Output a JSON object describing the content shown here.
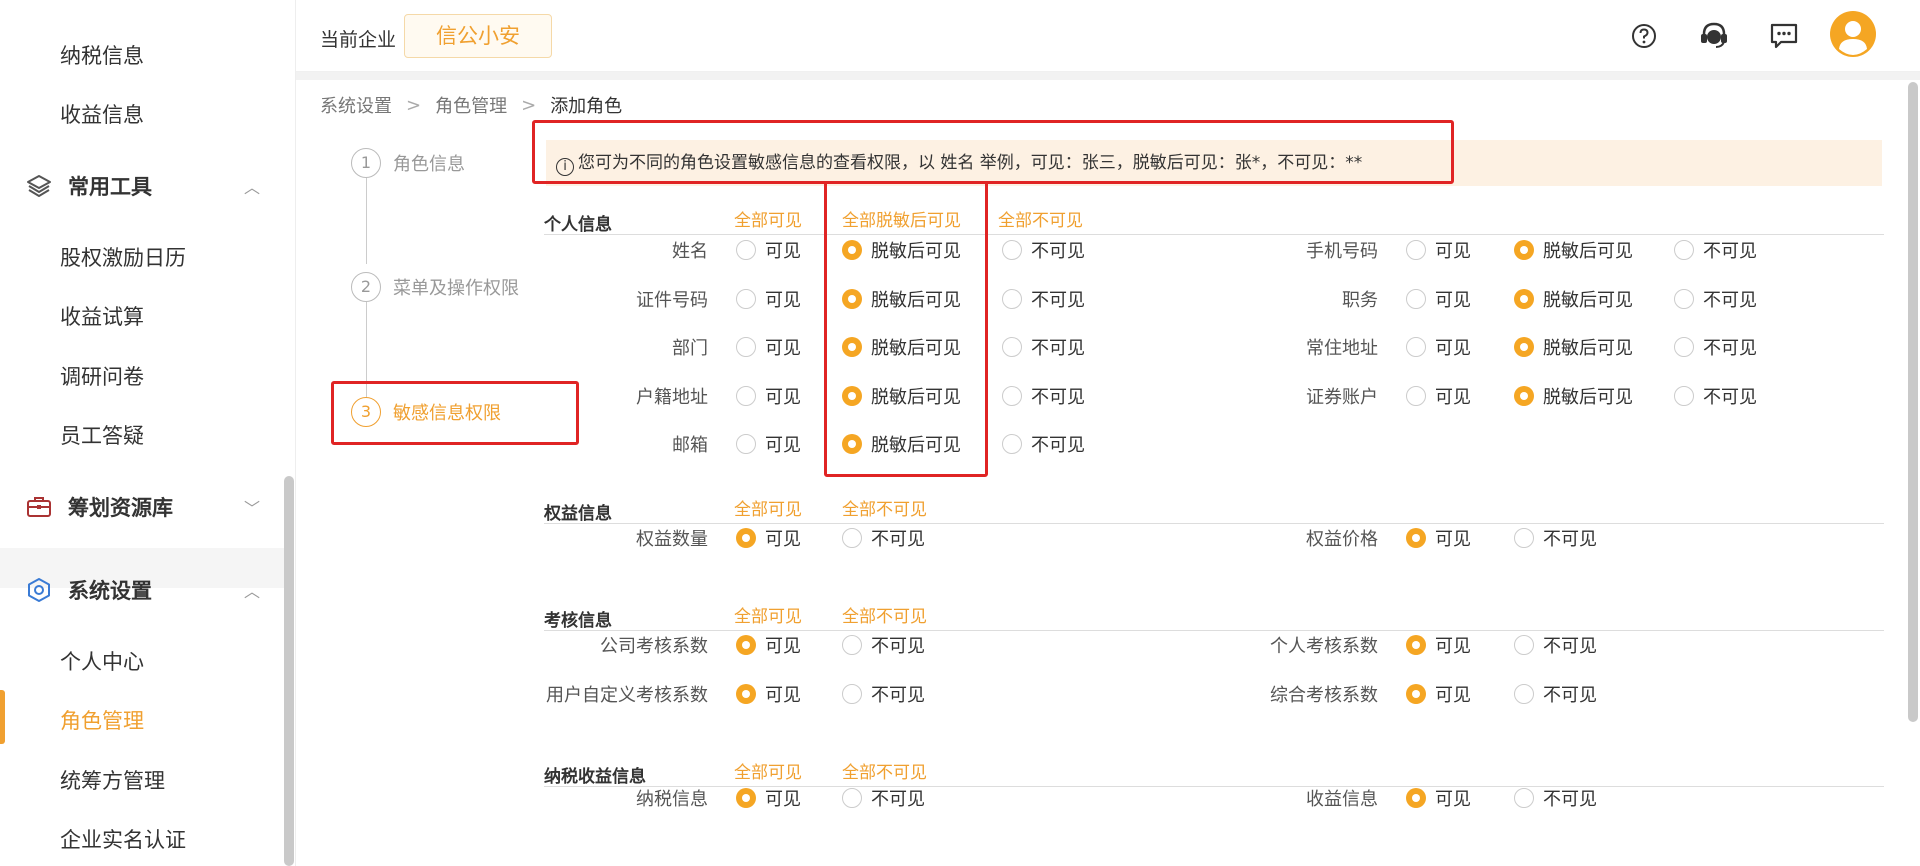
{
  "sidebar": {
    "top_items": [
      "纳税信息",
      "收益信息"
    ],
    "groups": [
      {
        "label": "常用工具",
        "items": [
          "股权激励日历",
          "收益试算",
          "调研问卷",
          "员工答疑"
        ],
        "expanded": true
      },
      {
        "label": "筹划资源库",
        "items": [],
        "expanded": false
      },
      {
        "label": "系统设置",
        "items": [
          "个人中心",
          "角色管理",
          "统筹方管理",
          "企业实名认证"
        ],
        "expanded": true
      }
    ],
    "active_item": "角色管理"
  },
  "header": {
    "current_company_label": "当前企业",
    "current_company": "信公小安",
    "icons": [
      "help-icon",
      "customer-service-icon",
      "message-icon",
      "avatar-icon"
    ]
  },
  "breadcrumb": [
    "系统设置",
    "角色管理",
    "添加角色"
  ],
  "steps": [
    {
      "num": "1",
      "label": "角色信息"
    },
    {
      "num": "2",
      "label": "菜单及操作权限"
    },
    {
      "num": "3",
      "label": "敏感信息权限",
      "active": true
    }
  ],
  "notice": "您可为不同的角色设置敏感信息的查看权限，以 姓名 举例，可见：张三，脱敏后可见：张*，不可见：**",
  "sections": {
    "personal": {
      "title": "个人信息",
      "links": [
        "全部可见",
        "全部脱敏后可见",
        "全部不可见"
      ],
      "options": [
        "可见",
        "脱敏后可见",
        "不可见"
      ],
      "left_fields": [
        {
          "label": "姓名",
          "selected": 1
        },
        {
          "label": "证件号码",
          "selected": 1
        },
        {
          "label": "部门",
          "selected": 1
        },
        {
          "label": "户籍地址",
          "selected": 1
        },
        {
          "label": "邮箱",
          "selected": 1
        }
      ],
      "right_fields": [
        {
          "label": "手机号码",
          "selected": 1
        },
        {
          "label": "职务",
          "selected": 1
        },
        {
          "label": "常住地址",
          "selected": 1
        },
        {
          "label": "证券账户",
          "selected": 1
        }
      ]
    },
    "equity": {
      "title": "权益信息",
      "links": [
        "全部可见",
        "全部不可见"
      ],
      "options": [
        "可见",
        "不可见"
      ],
      "left_fields": [
        {
          "label": "权益数量",
          "selected": 0
        }
      ],
      "right_fields": [
        {
          "label": "权益价格",
          "selected": 0
        }
      ]
    },
    "assessment": {
      "title": "考核信息",
      "links": [
        "全部可见",
        "全部不可见"
      ],
      "options": [
        "可见",
        "不可见"
      ],
      "left_fields": [
        {
          "label": "公司考核系数",
          "selected": 0
        },
        {
          "label": "用户自定义考核系数",
          "selected": 0
        }
      ],
      "right_fields": [
        {
          "label": "个人考核系数",
          "selected": 0
        },
        {
          "label": "综合考核系数",
          "selected": 0
        }
      ]
    },
    "tax": {
      "title": "纳税收益信息",
      "links": [
        "全部可见",
        "全部不可见"
      ],
      "options": [
        "可见",
        "不可见"
      ],
      "left_fields": [
        {
          "label": "纳税信息",
          "selected": 0
        }
      ],
      "right_fields": [
        {
          "label": "收益信息",
          "selected": 0
        }
      ]
    }
  },
  "colors": {
    "accent": "#f0a030",
    "annotation": "#e02424",
    "notice_bg": "#fdf1e3"
  }
}
